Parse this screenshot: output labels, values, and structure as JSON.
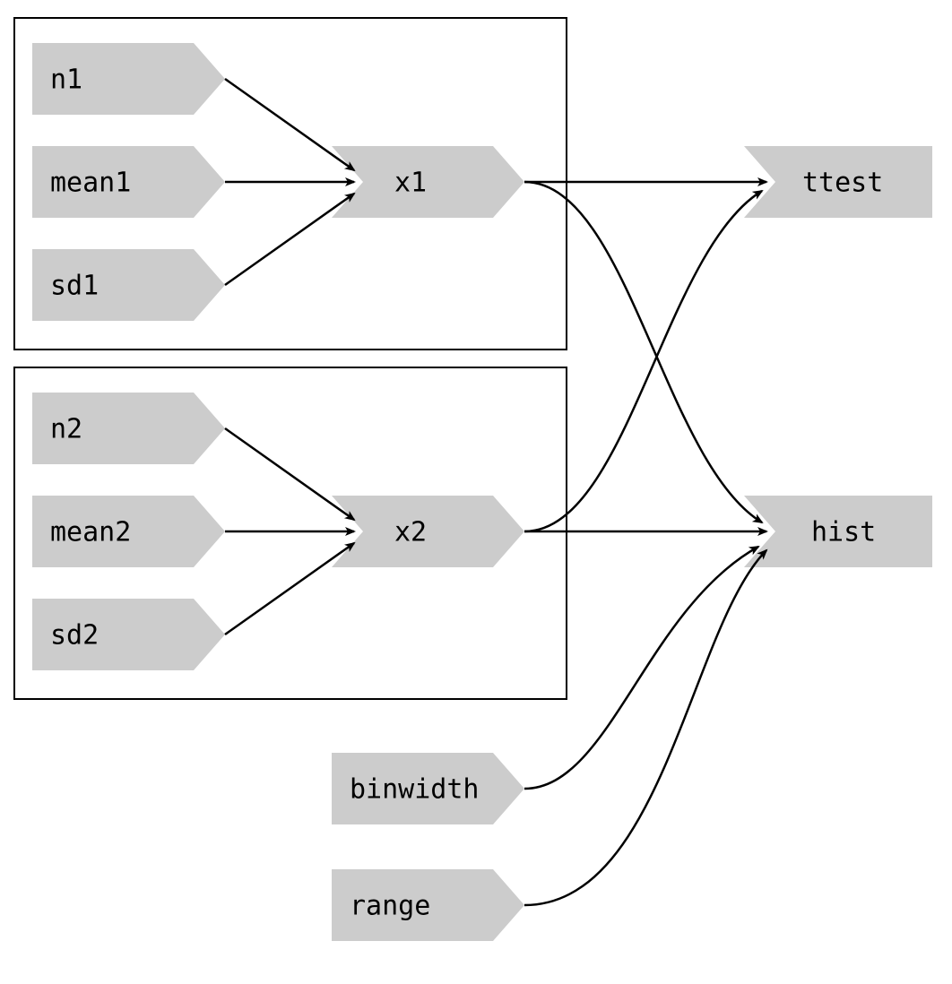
{
  "diagram": {
    "type": "reactive-dependency-graph",
    "groups": [
      {
        "id": "group1",
        "contains": [
          "n1",
          "mean1",
          "sd1",
          "x1"
        ]
      },
      {
        "id": "group2",
        "contains": [
          "n2",
          "mean2",
          "sd2",
          "x2"
        ]
      }
    ],
    "nodes": {
      "n1": {
        "label": "n1",
        "kind": "input"
      },
      "mean1": {
        "label": "mean1",
        "kind": "input"
      },
      "sd1": {
        "label": "sd1",
        "kind": "input"
      },
      "x1": {
        "label": "x1",
        "kind": "reactive"
      },
      "n2": {
        "label": "n2",
        "kind": "input"
      },
      "mean2": {
        "label": "mean2",
        "kind": "input"
      },
      "sd2": {
        "label": "sd2",
        "kind": "input"
      },
      "x2": {
        "label": "x2",
        "kind": "reactive"
      },
      "binwidth": {
        "label": "binwidth",
        "kind": "input"
      },
      "range": {
        "label": "range",
        "kind": "input"
      },
      "ttest": {
        "label": "ttest",
        "kind": "output"
      },
      "hist": {
        "label": "hist",
        "kind": "output"
      }
    },
    "edges": [
      {
        "from": "n1",
        "to": "x1"
      },
      {
        "from": "mean1",
        "to": "x1"
      },
      {
        "from": "sd1",
        "to": "x1"
      },
      {
        "from": "n2",
        "to": "x2"
      },
      {
        "from": "mean2",
        "to": "x2"
      },
      {
        "from": "sd2",
        "to": "x2"
      },
      {
        "from": "x1",
        "to": "ttest"
      },
      {
        "from": "x2",
        "to": "ttest"
      },
      {
        "from": "x1",
        "to": "hist"
      },
      {
        "from": "x2",
        "to": "hist"
      },
      {
        "from": "binwidth",
        "to": "hist"
      },
      {
        "from": "range",
        "to": "hist"
      }
    ],
    "colors": {
      "node_fill": "#cccccc",
      "stroke": "#000000",
      "background": "#ffffff"
    }
  }
}
